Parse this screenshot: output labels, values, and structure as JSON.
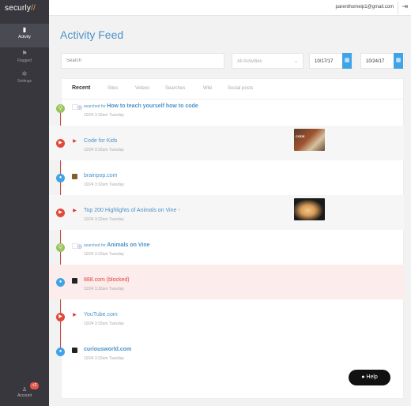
{
  "app": {
    "logo_main": "securly",
    "logo_accent": "//"
  },
  "sidebar": {
    "items": [
      {
        "label": "Activity",
        "icon": "activity-icon",
        "glyph": "▮"
      },
      {
        "label": "Flagged",
        "icon": "flag-icon",
        "glyph": "⚑"
      },
      {
        "label": "Settings",
        "icon": "gear-icon",
        "glyph": "✲"
      }
    ],
    "account": {
      "label": "Account",
      "glyph": "♙",
      "badge": "+2"
    }
  },
  "topbar": {
    "email": "parenthomeip1@gmail.com",
    "logout_glyph": "⇥"
  },
  "page": {
    "title": "Activity Feed"
  },
  "filters": {
    "search_placeholder": "Search",
    "activity_select": "All Activities",
    "chevron": "⌄",
    "date_from": "10/17/17",
    "date_to": "10/24/17",
    "cal_glyph": "▦"
  },
  "tabs": [
    "Recent",
    "Sites",
    "Videos",
    "Searches",
    "Wiki",
    "Social posts"
  ],
  "feed": [
    {
      "type": "search",
      "prefix": "searched for ",
      "text": "How to teach yourself how to code",
      "time": "10/24 3:32am Tuesday",
      "dot": "#9ac35a",
      "dot_glyph": "Q"
    },
    {
      "type": "video",
      "text": "Code for Kids",
      "time": "10/24 3:32am Tuesday",
      "dot": "#e04a3c",
      "dot_glyph": "▶",
      "thumb_text": "CODE"
    },
    {
      "type": "site",
      "text": "brainpop.com",
      "time": "10/24 3:32am Tuesday",
      "dot": "#3fa3e6",
      "dot_glyph": "●"
    },
    {
      "type": "video",
      "text": "Top 200 Highlights of Animals on Vine -",
      "time": "10/24 3:32am Tuesday",
      "dot": "#e04a3c",
      "dot_glyph": "▶"
    },
    {
      "type": "search",
      "prefix": "searched for ",
      "text": "Animals on Vine",
      "time": "10/24 3:32am Tuesday",
      "dot": "#9ac35a",
      "dot_glyph": "Q"
    },
    {
      "type": "blocked",
      "text": "888.com (blocked)",
      "time": "10/24 3:32am Tuesday",
      "dot": "#3fa3e6",
      "dot_glyph": "●"
    },
    {
      "type": "video",
      "text": "YouTube.com",
      "time": "10/24 3:32am Tuesday",
      "dot": "#e04a3c",
      "dot_glyph": "▶"
    },
    {
      "type": "site",
      "text": "curiousworld.com",
      "time": "10/24 3:32am Tuesday",
      "dot": "#3fa3e6",
      "dot_glyph": "●"
    }
  ],
  "help": {
    "label": "Help",
    "glyph": "?"
  }
}
